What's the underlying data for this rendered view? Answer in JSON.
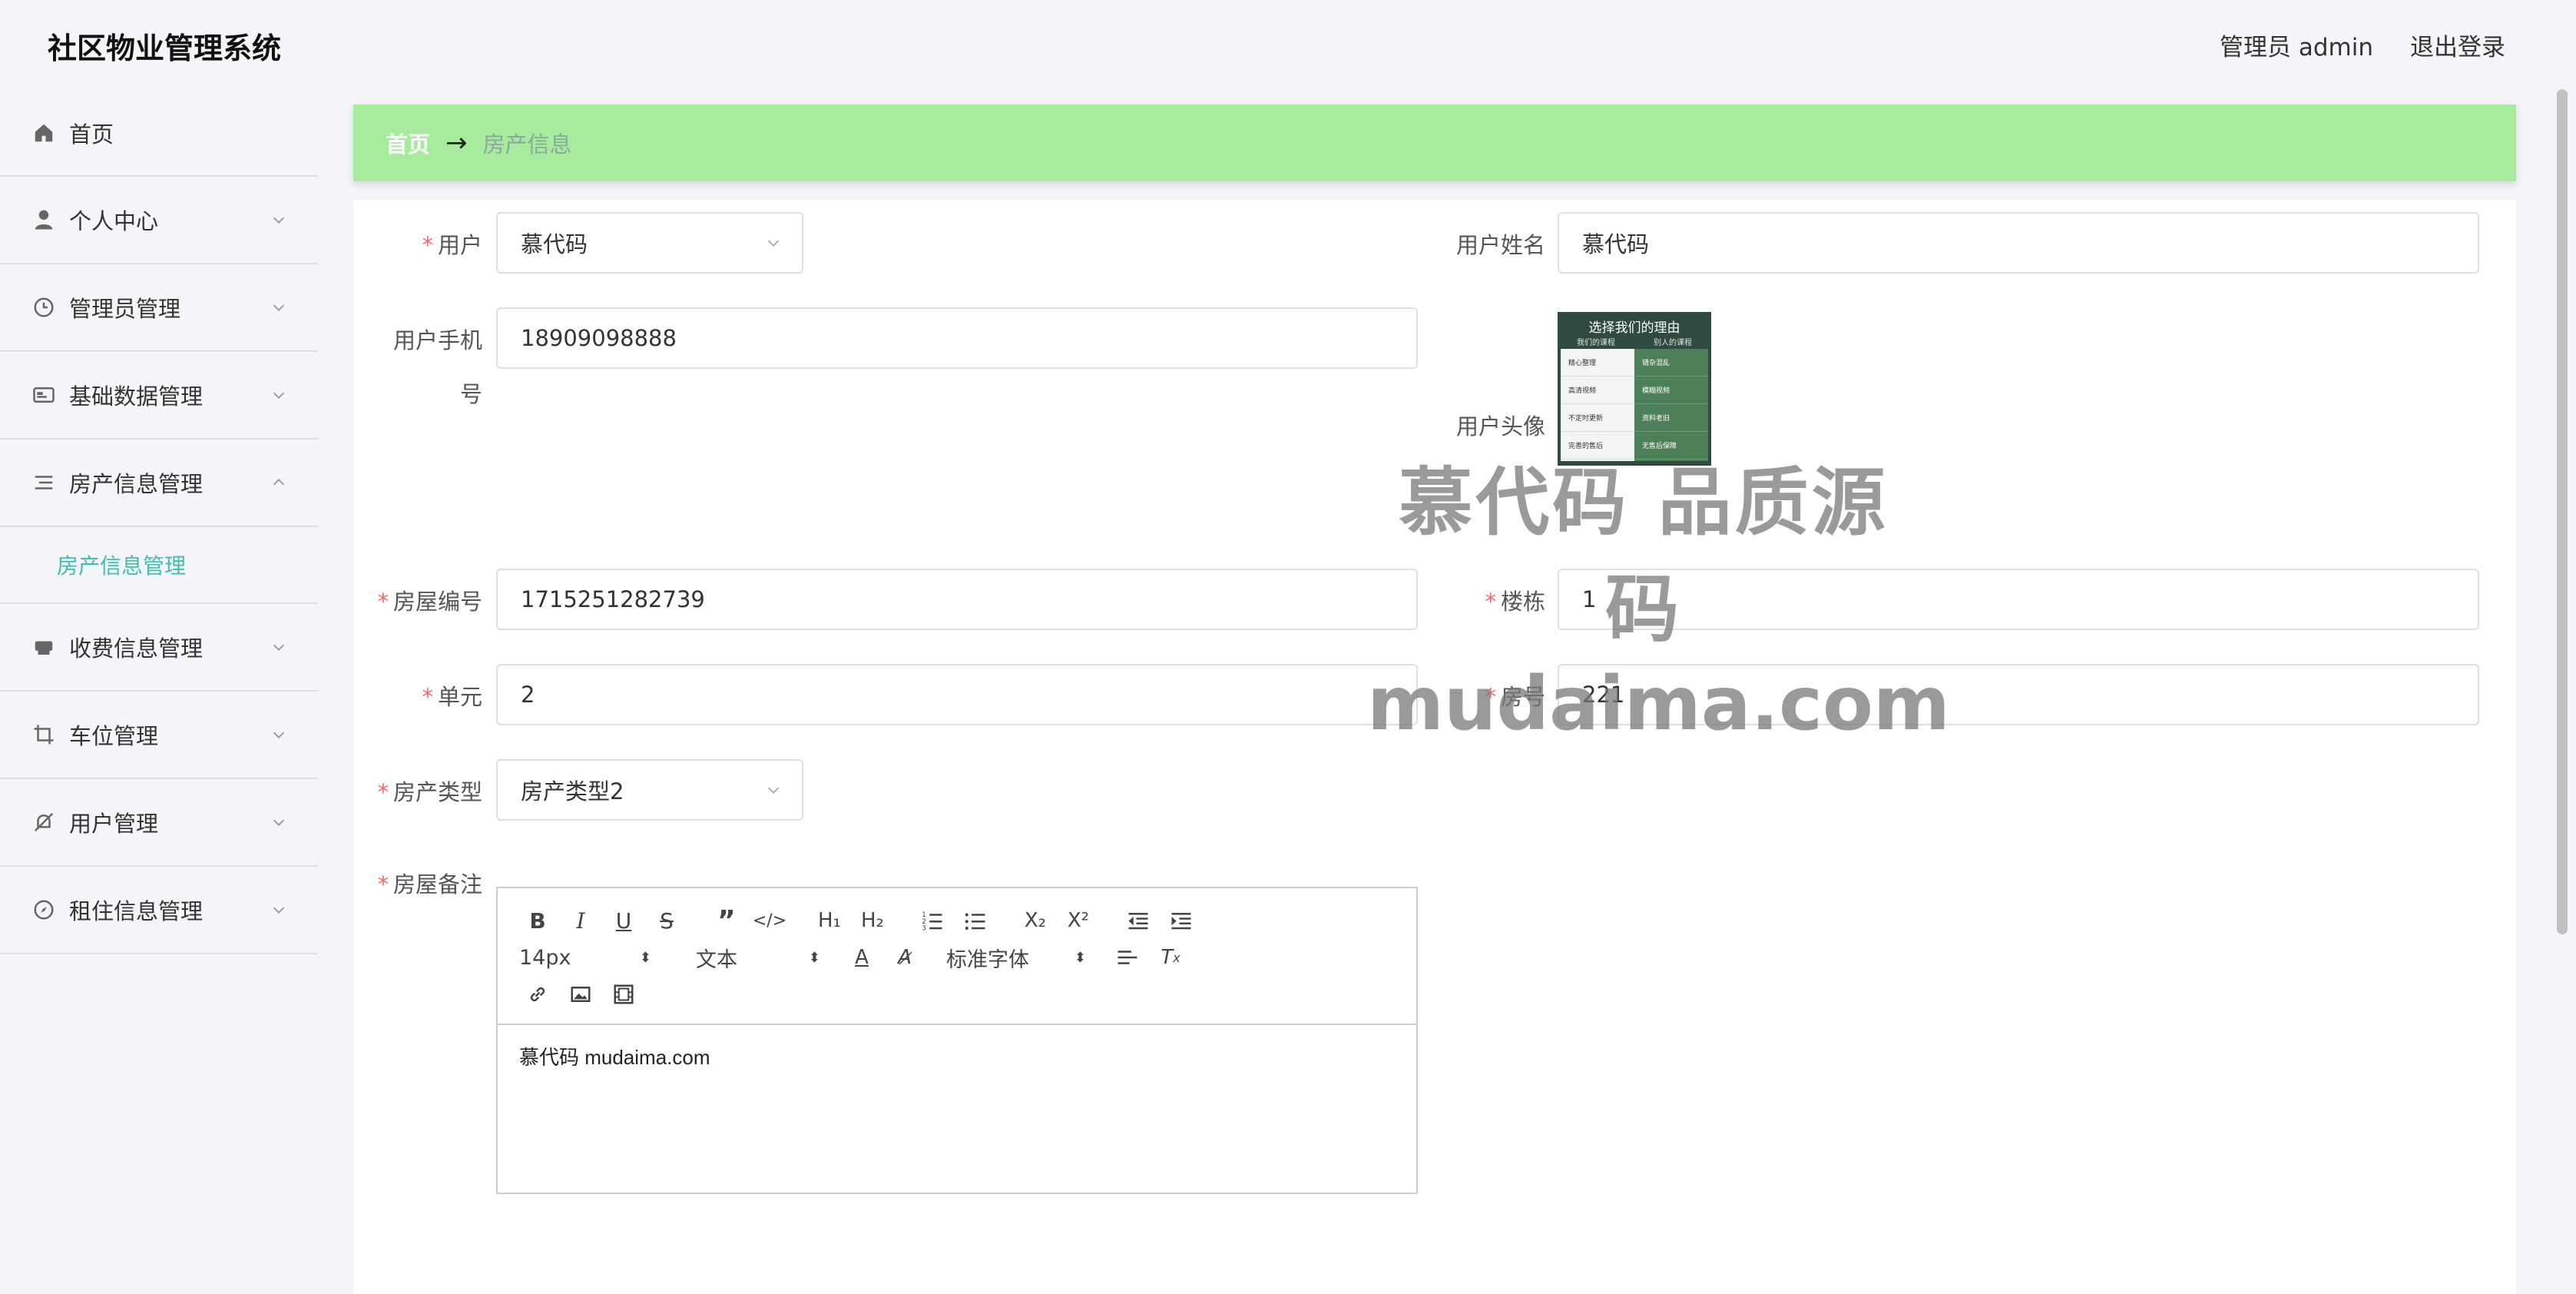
{
  "header": {
    "app_title": "社区物业管理系统",
    "user_label": "管理员 admin",
    "logout_label": "退出登录"
  },
  "sidebar": {
    "items": [
      {
        "label": "首页",
        "icon": "home-icon"
      },
      {
        "label": "个人中心",
        "icon": "user-icon"
      },
      {
        "label": "管理员管理",
        "icon": "clock-icon"
      },
      {
        "label": "基础数据管理",
        "icon": "id-card-icon"
      },
      {
        "label": "房产信息管理",
        "icon": "list-icon",
        "expanded": true,
        "sub": "房产信息管理"
      },
      {
        "label": "收费信息管理",
        "icon": "printer-icon"
      },
      {
        "label": "车位管理",
        "icon": "crop-icon"
      },
      {
        "label": "用户管理",
        "icon": "bell-off-icon"
      },
      {
        "label": "租住信息管理",
        "icon": "compass-icon"
      }
    ]
  },
  "breadcrumb": {
    "home": "首页",
    "current": "房产信息"
  },
  "form": {
    "user_label": "用户",
    "user_value": "慕代码",
    "user_name_label": "用户姓名",
    "user_name_value": "慕代码",
    "phone_label_1": "用户手机",
    "phone_label_2": "号",
    "phone_value": "18909098888",
    "avatar_label": "用户头像",
    "house_no_label": "房屋编号",
    "house_no_value": "1715251282739",
    "building_label": "楼栋",
    "building_value": "1",
    "unit_label": "单元",
    "unit_value": "2",
    "room_label": "房号",
    "room_value": "221",
    "type_label": "房产类型",
    "type_value": "房产类型2",
    "remark_label": "房屋备注",
    "remark_content": "慕代码 mudaima.com"
  },
  "avatar_image": {
    "title": "选择我们的理由",
    "left_head": "我们的课程",
    "right_head": "别人的课程",
    "left_rows": [
      "精心整理",
      "高清视频",
      "不定时更新",
      "完善的售后"
    ],
    "right_rows": [
      "错杂混乱",
      "模糊视频",
      "资料老旧",
      "无售后保障"
    ]
  },
  "watermark": {
    "line1": "慕代码 品质源码",
    "line2": "mudaima.com"
  },
  "editor": {
    "font_size": "14px",
    "header_select": "文本",
    "font_family": "标准字体"
  },
  "colors": {
    "breadcrumb_bg": "#a7eb9c",
    "accent": "#3fbfae",
    "required": "#f56c6c"
  }
}
